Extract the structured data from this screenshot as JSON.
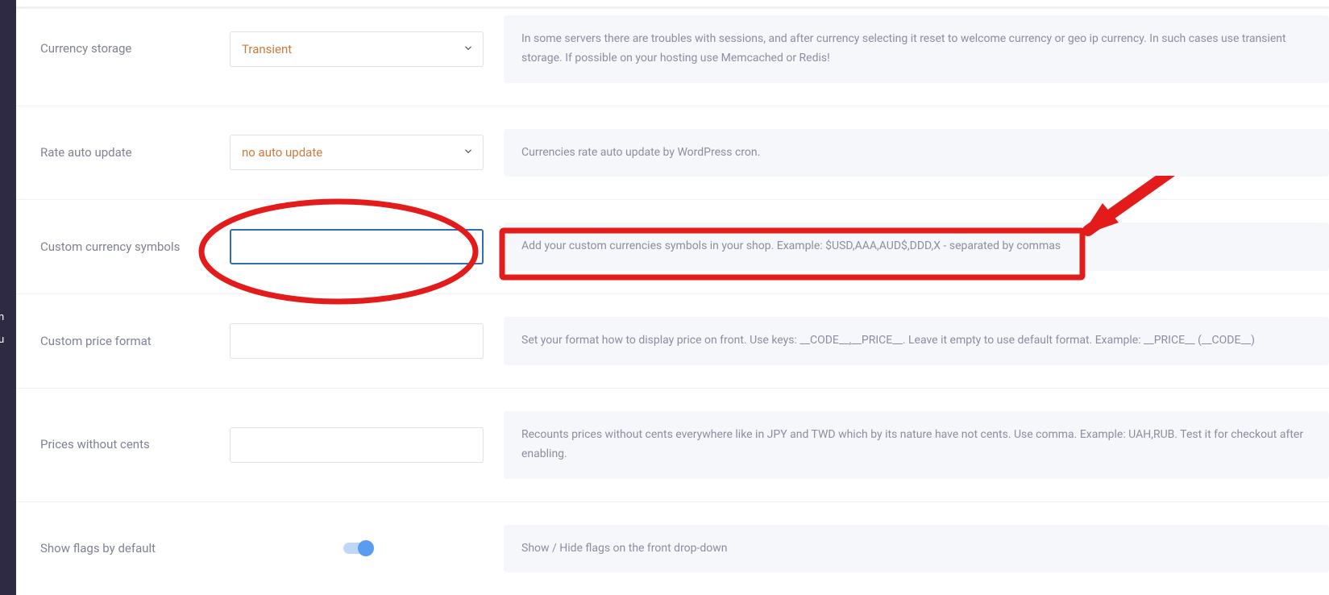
{
  "rows": {
    "currency_storage": {
      "label": "Currency storage",
      "value": "Transient",
      "desc": "In some servers there are troubles with sessions, and after currency selecting it reset to welcome currency or geo ip currency. In such cases use transient storage. If possible on your hosting use Memcached or Redis!"
    },
    "rate_auto_update": {
      "label": "Rate auto update",
      "value": "no auto update",
      "desc": "Currencies rate auto update by WordPress cron."
    },
    "custom_currency_symbols": {
      "label": "Custom currency symbols",
      "value": "",
      "desc": "Add your custom currencies symbols in your shop. Example: $USD,AAA,AUD$,DDD,X - separated by commas"
    },
    "custom_price_format": {
      "label": "Custom price format",
      "value": "",
      "desc": "Set your format how to display price on front. Use keys: __CODE__,__PRICE__. Leave it empty to use default format. Example: __PRICE__ (__CODE__)"
    },
    "prices_without_cents": {
      "label": "Prices without cents",
      "value": "",
      "desc": "Recounts prices without cents everywhere like in JPY and TWD which by its nature have not cents. Use comma. Example: UAH,RUB. Test it for checkout after enabling."
    },
    "show_flags_by_default": {
      "label": "Show flags by default",
      "desc": "Show / Hide flags on the front drop-down"
    }
  },
  "sidebar_hints": {
    "a": "n",
    "b": "u"
  }
}
